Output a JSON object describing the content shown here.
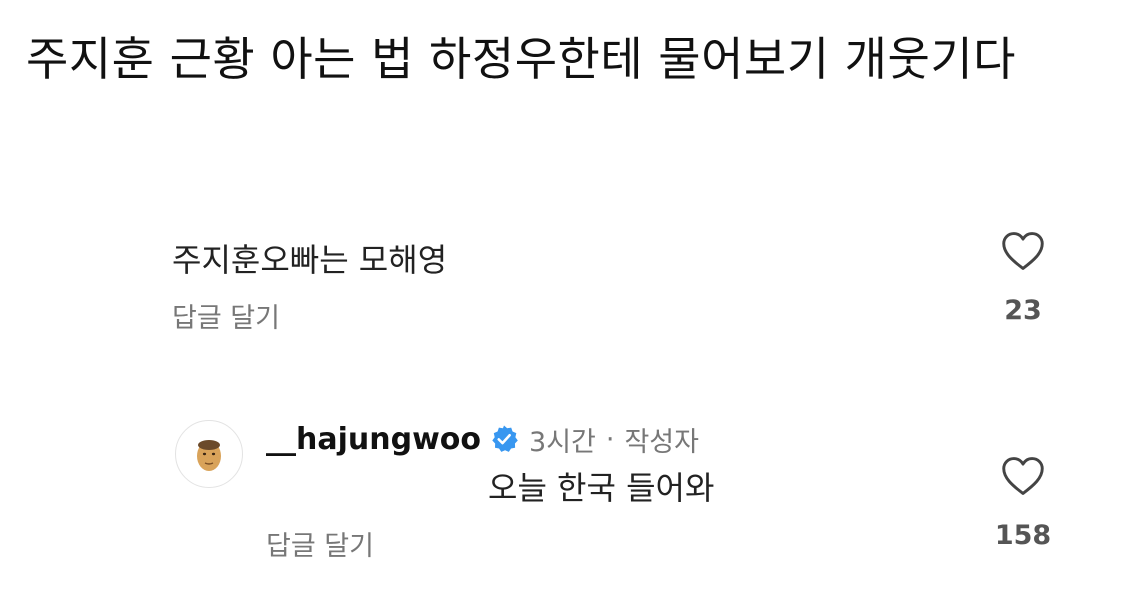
{
  "post": {
    "title": "주지훈 근황 아는 법 하정우한테 물어보기 개웃기다"
  },
  "comments": [
    {
      "text": "주지훈오빠는 모해영",
      "reply_label": "답글 달기",
      "likes": "23",
      "icon": "heart-outline-icon"
    },
    {
      "username": "__hajungwoo",
      "verified": true,
      "time": "3시간",
      "separator": "·",
      "author_label": "작성자",
      "text": "오늘 한국 들어와",
      "reply_label": "답글 달기",
      "likes": "158",
      "icon": "heart-outline-icon"
    }
  ],
  "colors": {
    "verified": "#3897f0",
    "muted_text": "#777777"
  }
}
